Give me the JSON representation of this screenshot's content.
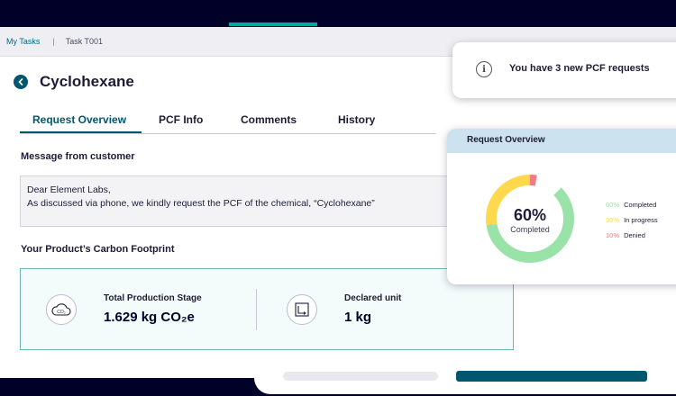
{
  "breadcrumb": {
    "root": "My Tasks",
    "current": "Task T001"
  },
  "header": {
    "title": "Cyclohexane"
  },
  "tabs": [
    {
      "label": "Request Overview",
      "active": true
    },
    {
      "label": "PCF Info",
      "active": false
    },
    {
      "label": "Comments",
      "active": false
    },
    {
      "label": "History",
      "active": false
    }
  ],
  "message": {
    "heading": "Message from customer",
    "greeting": "Dear Element Labs,",
    "body": "As discussed via phone, we kindly request the PCF of the chemical, “Cyclohexane”"
  },
  "footprint": {
    "heading": "Your Product’s Carbon Footprint",
    "production_label": "Total Production Stage",
    "production_value": "1.629 kg CO₂e",
    "unit_label": "Declared unit",
    "unit_value": "1 kg",
    "co2_icon_text": "CO₂"
  },
  "notification": {
    "text": "You have 3 new PCF requests"
  },
  "overview": {
    "title": "Request Overview",
    "center_value": "60%",
    "center_label": "Completed",
    "legend": [
      {
        "pct": "60%",
        "label": "Completed",
        "value": 60,
        "color": "#99e3a8"
      },
      {
        "pct": "30%",
        "label": "In progress",
        "value": 30,
        "color": "#ffd94d"
      },
      {
        "pct": "10%",
        "label": "Denied",
        "value": 10,
        "color": "#f47a84"
      }
    ]
  },
  "colors": {
    "brand": "#00576e",
    "accent": "#00a79d",
    "dark": "#000028"
  },
  "icons": [
    "chevron-left-icon",
    "info-icon",
    "co2-cloud-icon",
    "declared-unit-icon"
  ]
}
